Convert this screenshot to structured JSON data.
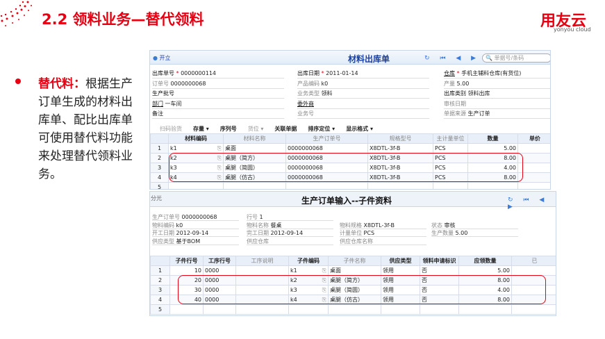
{
  "slide": {
    "title": "2.2 领料业务—替代领料",
    "logo": "用友云",
    "logo_sub": "yonyou cloud",
    "bullet_label": "替代料：",
    "bullet_text": "根据生产订单生成的材料出库单、配比出库单可使用替代料功能来处理替代领料业务。"
  },
  "win1": {
    "status": "开立",
    "title": "材料出库单",
    "search_placeholder": "单据号/条码",
    "fields": [
      {
        "label": "出库单号",
        "value": "0000000114",
        "req": true,
        "style": "b"
      },
      {
        "label": "出库日期",
        "value": "2011-01-14",
        "req": true,
        "style": "b"
      },
      {
        "label": "仓库",
        "value": "手机主辅料仓库(有货位)",
        "req": true,
        "style": "u"
      },
      {
        "label": "订单号",
        "value": "0000000068",
        "style": ""
      },
      {
        "label": "产品编码",
        "value": "k0",
        "style": ""
      },
      {
        "label": "产量",
        "value": "5.00",
        "style": ""
      },
      {
        "label": "生产批号",
        "value": "",
        "style": "b"
      },
      {
        "label": "业务类型",
        "value": "领料",
        "style": ""
      },
      {
        "label": "出库类别",
        "value": "领料出库",
        "style": "b"
      },
      {
        "label": "部门",
        "value": "一车间",
        "style": "u"
      },
      {
        "label": "委外商",
        "value": "",
        "style": "u"
      },
      {
        "label": "审核日期",
        "value": "",
        "style": ""
      },
      {
        "label": "备注",
        "value": "",
        "style": "b"
      },
      {
        "label": "业务号",
        "value": "",
        "style": ""
      },
      {
        "label": "单据来源",
        "value": "生产订单",
        "style": ""
      }
    ],
    "toolbar": [
      "扫码验货",
      "存量 ▾",
      "序列号",
      "货位 ▾",
      "关联单据",
      "排序定位 ▾",
      "显示格式 ▾"
    ],
    "columns": [
      "",
      "材料编码",
      "材料名称",
      "生产订单号",
      "规格型号",
      "主计量单位",
      "数量",
      "单价"
    ],
    "rows": [
      [
        "1",
        "k1",
        "桌面",
        "0000000068",
        "X8DTL-3f-B",
        "PCS",
        "5.00",
        ""
      ],
      [
        "2",
        "k2",
        "桌腿（简方）",
        "0000000068",
        "X8DTL-3f-B",
        "PCS",
        "8.00",
        ""
      ],
      [
        "3",
        "k3",
        "桌腿（简圆）",
        "0000000068",
        "X8DTL-3f-B",
        "PCS",
        "4.00",
        ""
      ],
      [
        "4",
        "k4",
        "桌腿（仿古）",
        "0000000068",
        "X8DTL-3f-B",
        "PCS",
        "8.00",
        ""
      ],
      [
        "5",
        "",
        "",
        "",
        "",
        "",
        "",
        ""
      ]
    ]
  },
  "win2": {
    "corner": "分光",
    "title": "生产订单输入--子件资料",
    "fields": [
      {
        "label": "生产订单号",
        "value": "0000000068"
      },
      {
        "label": "行号",
        "value": "1"
      },
      {
        "label": "",
        "value": ""
      },
      {
        "label": "",
        "value": ""
      },
      {
        "label": "物料编码",
        "value": "k0"
      },
      {
        "label": "物料名称",
        "value": "餐桌"
      },
      {
        "label": "物料规格",
        "value": "X8DTL-3f-B"
      },
      {
        "label": "状态",
        "value": "审核"
      },
      {
        "label": "开工日期",
        "value": "2012-09-14"
      },
      {
        "label": "完工日期",
        "value": "2012-09-14"
      },
      {
        "label": "计量单位",
        "value": "PCS"
      },
      {
        "label": "生产数量",
        "value": "5.00"
      },
      {
        "label": "供应类型",
        "value": "基于BOM"
      },
      {
        "label": "供应仓库",
        "value": ""
      },
      {
        "label": "供应仓库名称",
        "value": ""
      },
      {
        "label": "",
        "value": ""
      }
    ],
    "columns": [
      "",
      "子件行号",
      "工序行号",
      "工序说明",
      "子件编码",
      "子件名称",
      "供应类型",
      "领料申请标识",
      "应领数量",
      "已"
    ],
    "rows": [
      [
        "1",
        "10",
        "0000",
        "",
        "k1",
        "桌面",
        "领用",
        "否",
        "5.00",
        ""
      ],
      [
        "2",
        "20",
        "0000",
        "",
        "k2",
        "桌腿（简方）",
        "领用",
        "否",
        "8.00",
        ""
      ],
      [
        "3",
        "30",
        "0000",
        "",
        "k3",
        "桌腿（简圆）",
        "领用",
        "否",
        "4.00",
        ""
      ],
      [
        "4",
        "40",
        "0000",
        "",
        "k4",
        "桌腿（仿古）",
        "领用",
        "否",
        "8.00",
        ""
      ],
      [
        "5",
        "",
        "",
        "",
        "",
        "",
        "",
        "",
        "",
        ""
      ]
    ]
  },
  "colors": {
    "accent": "#e60012",
    "header_blue": "#1a3fa0"
  }
}
